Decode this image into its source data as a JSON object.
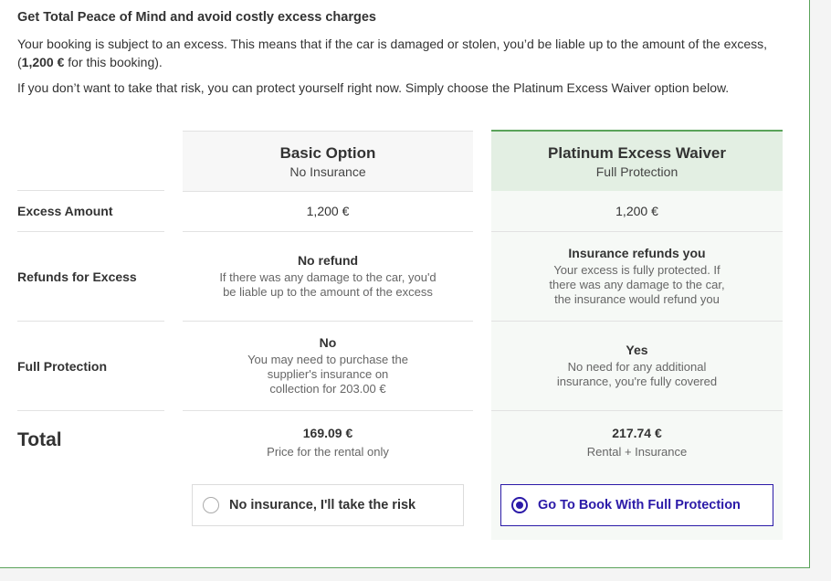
{
  "intro": {
    "heading": "Get Total Peace of Mind and avoid costly excess charges",
    "para1_before": "Your booking is subject to an excess. This means that if the car is damaged or stolen, you’d be liable up to the amount of the excess, (",
    "para1_bold": "1,200 €",
    "para1_after": " for this booking).",
    "para2": "If you don’t want to take that risk, you can protect yourself right now. Simply choose the Platinum Excess Waiver option below."
  },
  "columns": {
    "basic": {
      "title": "Basic Option",
      "subtitle": "No Insurance"
    },
    "platinum": {
      "title": "Platinum Excess Waiver",
      "subtitle": "Full Protection"
    }
  },
  "rows": {
    "excess": {
      "label": "Excess Amount",
      "basic": "1,200 €",
      "platinum": "1,200 €"
    },
    "refunds": {
      "label": "Refunds for Excess",
      "basic_title": "No refund",
      "basic_desc": "If there was any damage to the car, you'd be liable up to the amount of the excess",
      "platinum_title": "Insurance refunds you",
      "platinum_desc": "Your excess is fully protected. If there was any damage to the car, the insurance would refund you"
    },
    "protection": {
      "label": "Full Protection",
      "basic_title": "No",
      "basic_desc": "You may need to purchase the supplier's insurance on collection for 203.00 €",
      "platinum_title": "Yes",
      "platinum_desc": "No need for any additional insurance, you're fully covered"
    },
    "total": {
      "label": "Total",
      "basic_price": "169.09 €",
      "basic_desc": "Price for the rental only",
      "platinum_price": "217.74 €",
      "platinum_desc": "Rental + Insurance"
    }
  },
  "choices": {
    "basic_label": "No insurance, I'll take the risk",
    "platinum_label": "Go To Book With Full Protection",
    "selected": "platinum"
  },
  "colors": {
    "accent_green": "#5aa35a",
    "selected_blue": "#2b1aa8",
    "platinum_header_bg": "#e3efe3"
  }
}
